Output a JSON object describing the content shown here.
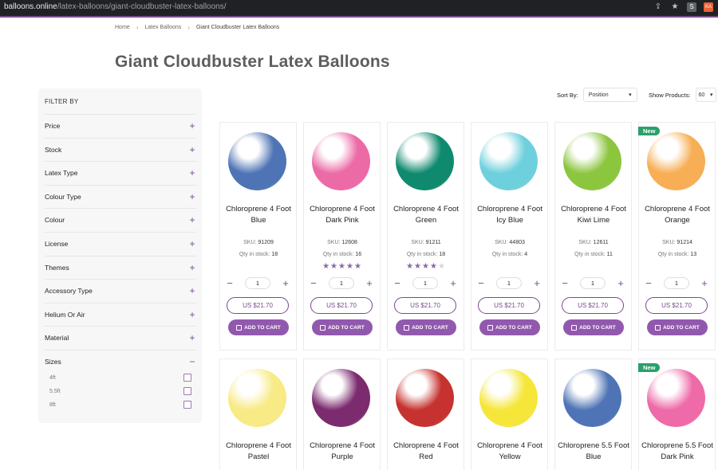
{
  "browser": {
    "host": "balloons.online",
    "path": "/latex-balloons/giant-cloudbuster-latex-balloons/",
    "ext1": "S",
    "ext2": "KA"
  },
  "breadcrumb": [
    "Home",
    "Latex Balloons",
    "Giant Cloudbuster Latex Balloons"
  ],
  "page_title": "Giant Cloudbuster Latex Balloons",
  "sidebar": {
    "title": "FILTER BY",
    "filters": [
      "Price",
      "Stock",
      "Latex Type",
      "Colour Type",
      "Colour",
      "License",
      "Themes",
      "Accessory Type",
      "Helium Or Air",
      "Material"
    ],
    "sizes_label": "Sizes",
    "sizes": [
      "4ft",
      "5.5ft",
      "8ft"
    ]
  },
  "sort": {
    "sort_label": "Sort By:",
    "sort_value": "Position",
    "show_label": "Show Products:",
    "show_value": "60"
  },
  "labels": {
    "sku": "SKU:",
    "qty": "Qty in stock:",
    "add_to_cart": "ADD TO CART",
    "new_badge": "New",
    "minus": "−",
    "plus": "+"
  },
  "products_row1": [
    {
      "name": "Chloroprene 4 Foot Blue",
      "sku": "91209",
      "stock": "18",
      "rating": 0,
      "qty": "1",
      "price": "US $21.70",
      "color": "#4f74b5",
      "is_new": false
    },
    {
      "name": "Chloroprene 4 Foot Dark Pink",
      "sku": "12608",
      "stock": "16",
      "rating": 5,
      "qty": "1",
      "price": "US $21.70",
      "color": "#ec6aa6",
      "is_new": false
    },
    {
      "name": "Chloroprene 4 Foot Green",
      "sku": "91211",
      "stock": "18",
      "rating": 4,
      "qty": "1",
      "price": "US $21.70",
      "color": "#0f8a6e",
      "is_new": false
    },
    {
      "name": "Chloroprene 4 Foot Icy Blue",
      "sku": "44803",
      "stock": "4",
      "rating": 0,
      "qty": "1",
      "price": "US $21.70",
      "color": "#6fd0dd",
      "is_new": false
    },
    {
      "name": "Chloroprene 4 Foot Kiwi Lime",
      "sku": "12611",
      "stock": "11",
      "rating": 0,
      "qty": "1",
      "price": "US $21.70",
      "color": "#8cc63f",
      "is_new": false
    },
    {
      "name": "Chloroprene 4 Foot Orange",
      "sku": "91214",
      "stock": "13",
      "rating": 0,
      "qty": "1",
      "price": "US $21.70",
      "color": "#f7ae55",
      "is_new": true
    }
  ],
  "products_row2": [
    {
      "name": "Chloroprene 4 Foot Pastel",
      "color": "#f8ea84",
      "is_new": false
    },
    {
      "name": "Chloroprene 4 Foot Purple",
      "color": "#7b2b6e",
      "is_new": false
    },
    {
      "name": "Chloroprene 4 Foot Red",
      "color": "#c6322f",
      "is_new": false
    },
    {
      "name": "Chloroprene 4 Foot Yellow",
      "color": "#f6e63a",
      "is_new": false
    },
    {
      "name": "Chloroprene 5.5 Foot Blue",
      "color": "#4f74b5",
      "is_new": false
    },
    {
      "name": "Chloroprene 5.5 Foot Dark Pink",
      "color": "#ee6aa8",
      "is_new": true
    }
  ]
}
